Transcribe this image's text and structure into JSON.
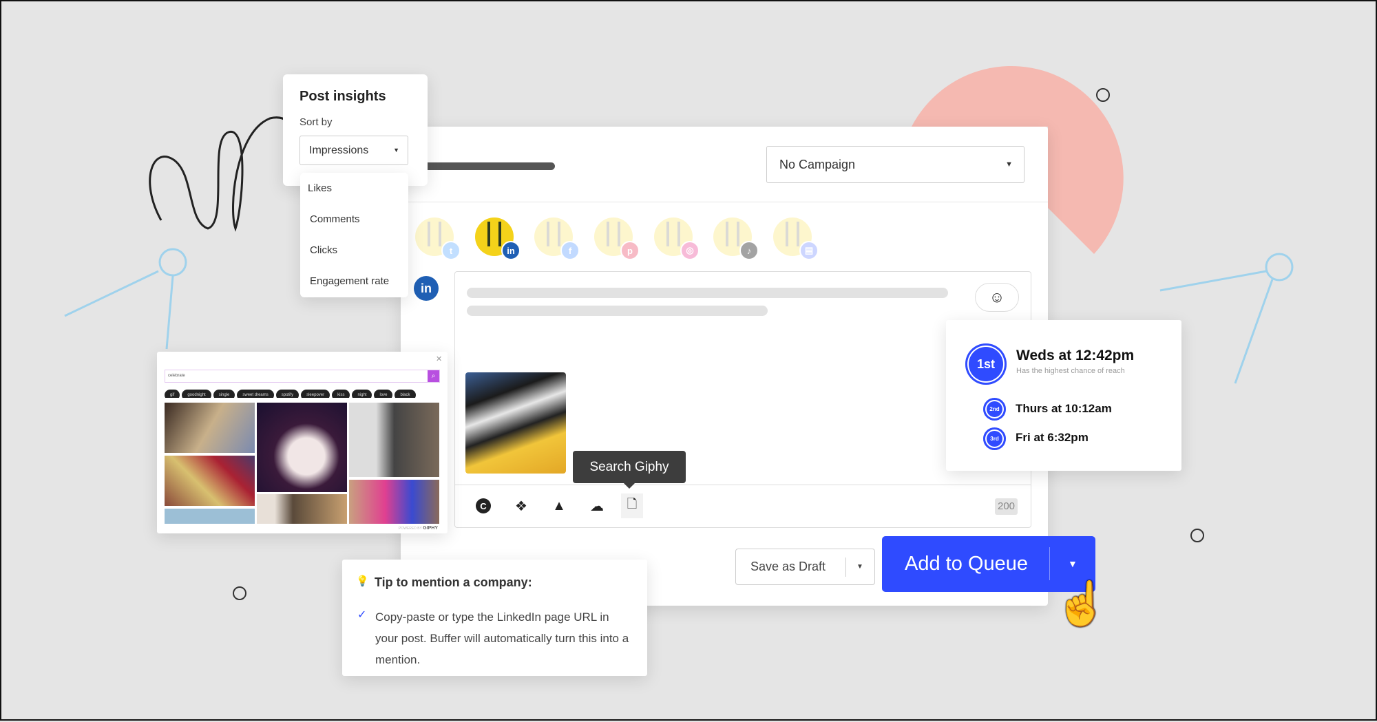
{
  "insights": {
    "title": "Post insights",
    "sort_label": "Sort by",
    "sort_value": "Impressions",
    "options": [
      "Likes",
      "Comments",
      "Clicks",
      "Engagement rate"
    ]
  },
  "composer": {
    "campaign_select": "No Campaign",
    "profiles": [
      {
        "network": "twitter",
        "icon": "twitter-icon",
        "color": "#bcdcff",
        "glyph": "t",
        "selected": false
      },
      {
        "network": "linkedin",
        "icon": "linkedin-icon",
        "color": "#1f5fb4",
        "glyph": "in",
        "selected": true
      },
      {
        "network": "facebook",
        "icon": "facebook-icon",
        "color": "#bcd6ff",
        "glyph": "f",
        "selected": false
      },
      {
        "network": "pinterest",
        "icon": "pinterest-icon",
        "color": "#f7b4c0",
        "glyph": "p",
        "selected": false
      },
      {
        "network": "instagram",
        "icon": "instagram-icon",
        "color": "#f7b4d4",
        "glyph": "◎",
        "selected": false
      },
      {
        "network": "tiktok",
        "icon": "tiktok-icon",
        "color": "#9a9a9a",
        "glyph": "♪",
        "selected": false
      },
      {
        "network": "google-business",
        "icon": "google-business-icon",
        "color": "#c8d2ff",
        "glyph": "▤",
        "selected": false
      }
    ],
    "active_network_glyph": "in",
    "tooltip": "Search Giphy",
    "char_count": "200",
    "toolbar_icons": [
      "canva-icon",
      "dropbox-icon",
      "google-drive-icon",
      "cloud-icon",
      "file-icon"
    ],
    "canva_glyph": "C"
  },
  "actions": {
    "save_draft": "Save as Draft",
    "add_queue": "Add to Queue",
    "accent": "#2f4bff"
  },
  "schedule": {
    "first": {
      "rank": "1st",
      "time": "Weds at 12:42pm",
      "note": "Has the highest chance of reach"
    },
    "second": {
      "rank": "2nd",
      "time": "Thurs at 10:12am"
    },
    "third": {
      "rank": "3rd",
      "time": "Fri at 6:32pm"
    }
  },
  "giphy": {
    "query": "celebrate",
    "tags": [
      "gif",
      "goodnight",
      "single",
      "sweet dreams",
      "spotify",
      "sleepover",
      "kiss",
      "night",
      "love",
      "black"
    ],
    "powered": "POWERED BY",
    "brand": "GIPHY"
  },
  "tip": {
    "title": "Tip to mention a company:",
    "body": "Copy-paste or type the LinkedIn page URL in your post. Buffer will automatically turn this into a mention."
  }
}
